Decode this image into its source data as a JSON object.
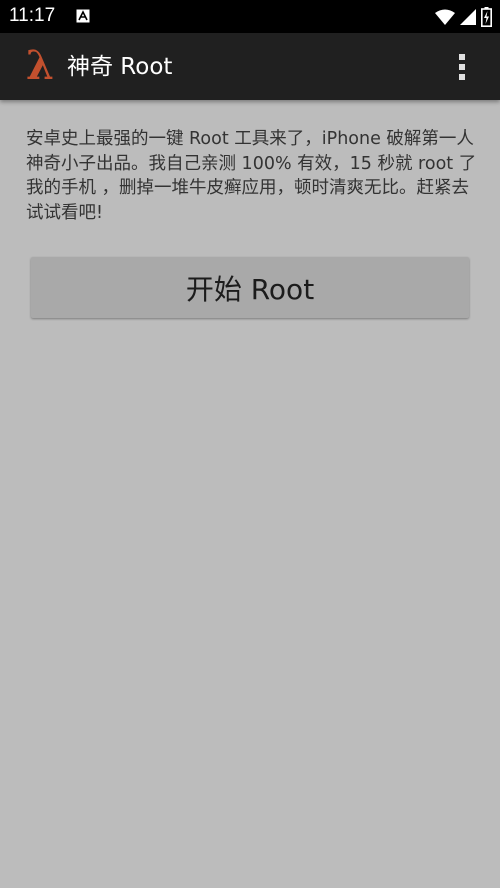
{
  "status_bar": {
    "time": "11:17",
    "notification_icon": "accessibility-a-icon",
    "icons": [
      "wifi-icon",
      "cell-signal-icon",
      "battery-icon"
    ]
  },
  "action_bar": {
    "logo_icon": "lambda-icon",
    "logo_glyph": "λ",
    "title": "神奇 Root",
    "menu_icon": "overflow-menu-icon",
    "accent_color": "#c2502e"
  },
  "main": {
    "description": "安卓史上最强的一键 Root 工具来了，iPhone 破解第一人神奇小子出品。我自己亲测 100% 有效，15 秒就 root 了我的手机 ，删掉一堆牛皮癣应用，顿时清爽无比。赶紧去试试看吧!",
    "button_label": "开始 Root"
  }
}
